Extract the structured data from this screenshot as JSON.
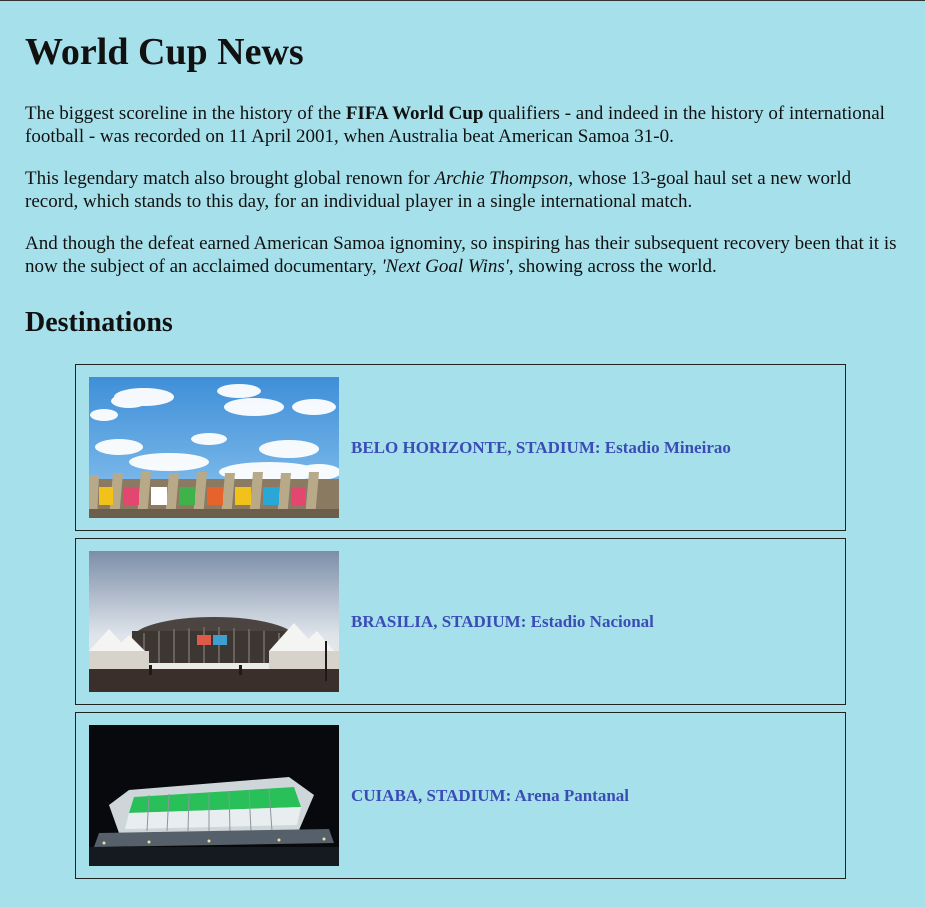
{
  "page": {
    "title": "World Cup News",
    "paragraph1": {
      "before": "The biggest scoreline in the history of the ",
      "bold": "FIFA World Cup",
      "after": " qualifiers - and indeed in the history of international football - was recorded on 11 April 2001, when Australia beat American Samoa 31-0."
    },
    "paragraph2": {
      "before": "This legendary match also brought global renown for ",
      "italic": "Archie Thompson",
      "after": ", whose 13-goal haul set a new world record, which stands to this day, for an individual player in a single international match."
    },
    "paragraph3": {
      "before": "And though the defeat earned American Samoa ignominy, so inspiring has their subsequent recovery been that it is now the subject of an acclaimed documentary, ",
      "italic": "'Next Goal Wins'",
      "after": ", showing across the world."
    },
    "destinations_heading": "Destinations"
  },
  "destinations": [
    {
      "label": "BELO HORIZONTE, STADIUM: Estadio Mineirao",
      "image": "stadium-mineirao-photo"
    },
    {
      "label": "BRASILIA, STADIUM: Estadio Nacional",
      "image": "stadium-nacional-photo"
    },
    {
      "label": "CUIABA, STADIUM: Arena Pantanal",
      "image": "stadium-pantanal-photo"
    }
  ],
  "colors": {
    "background": "#a6e0eb",
    "link": "#3b4db4",
    "border": "#222222"
  }
}
